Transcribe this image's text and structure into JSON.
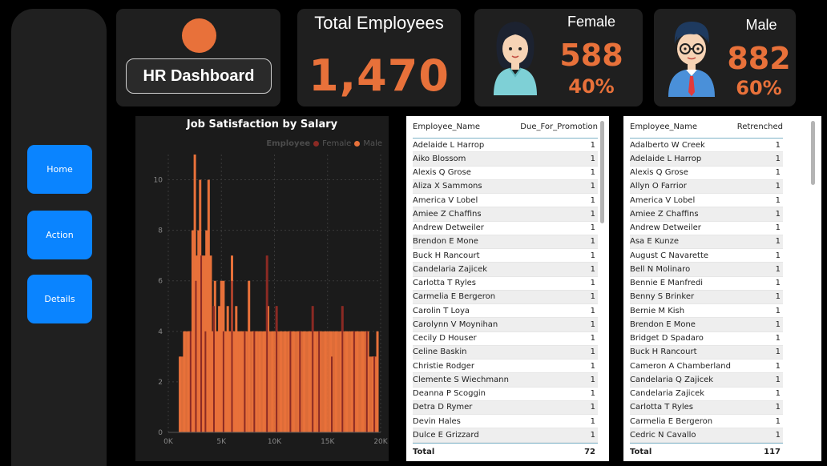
{
  "nav": {
    "home": "Home",
    "action": "Action",
    "details": "Details"
  },
  "header": {
    "dashboard_title": "HR Dashboard"
  },
  "kpi": {
    "total_title": "Total Employees",
    "total_value": "1,470",
    "female_title": "Female",
    "female_value": "588",
    "female_pct": "40%",
    "male_title": "Male",
    "male_value": "882",
    "male_pct": "60%"
  },
  "colors": {
    "accent": "#e8713a",
    "female_series": "#8b2a24",
    "male_series": "#e8713a",
    "nav_button": "#0a84ff"
  },
  "chart_data": {
    "type": "bar",
    "title": "Job Satisfaction by Salary",
    "legend_title": "Employee",
    "legend_position": "top-right",
    "xlim": [
      0,
      20000
    ],
    "ylim": [
      0,
      11
    ],
    "x_ticks": [
      "0K",
      "5K",
      "10K",
      "15K",
      "20K"
    ],
    "y_ticks": [
      "0",
      "2",
      "4",
      "6",
      "8",
      "10"
    ],
    "grid": true,
    "series": [
      {
        "name": "Female",
        "color": "#8b2a24",
        "points": [
          [
            2100,
            4
          ],
          [
            2600,
            6
          ],
          [
            3100,
            7
          ],
          [
            3500,
            4
          ],
          [
            4300,
            5
          ],
          [
            5200,
            4
          ],
          [
            6000,
            6
          ],
          [
            7200,
            4
          ],
          [
            8100,
            4
          ],
          [
            9300,
            7
          ],
          [
            10200,
            5
          ],
          [
            11500,
            4
          ],
          [
            12400,
            4
          ],
          [
            13600,
            5
          ],
          [
            14200,
            4
          ],
          [
            15400,
            3
          ],
          [
            16400,
            5
          ],
          [
            17500,
            4
          ],
          [
            18700,
            4
          ],
          [
            19400,
            3
          ]
        ]
      },
      {
        "name": "Male",
        "color": "#e8713a",
        "points": [
          [
            1100,
            3
          ],
          [
            1500,
            4
          ],
          [
            1900,
            4
          ],
          [
            2300,
            8
          ],
          [
            2500,
            11
          ],
          [
            2700,
            7
          ],
          [
            2850,
            8
          ],
          [
            3000,
            10
          ],
          [
            3200,
            7
          ],
          [
            3400,
            7
          ],
          [
            3600,
            8
          ],
          [
            3800,
            10
          ],
          [
            4000,
            7
          ],
          [
            4200,
            4
          ],
          [
            4400,
            6
          ],
          [
            4600,
            4
          ],
          [
            4800,
            5
          ],
          [
            5000,
            6
          ],
          [
            5200,
            6
          ],
          [
            5400,
            4
          ],
          [
            5600,
            5
          ],
          [
            5800,
            4
          ],
          [
            6000,
            7
          ],
          [
            6200,
            4
          ],
          [
            6400,
            5
          ],
          [
            6600,
            4
          ],
          [
            6800,
            4
          ],
          [
            7000,
            4
          ],
          [
            7300,
            4
          ],
          [
            7600,
            6
          ],
          [
            8000,
            4
          ],
          [
            8300,
            4
          ],
          [
            8600,
            4
          ],
          [
            9000,
            4
          ],
          [
            9400,
            5
          ],
          [
            9800,
            4
          ],
          [
            10200,
            4
          ],
          [
            10600,
            4
          ],
          [
            11000,
            4
          ],
          [
            11400,
            4
          ],
          [
            11800,
            4
          ],
          [
            12300,
            4
          ],
          [
            12800,
            4
          ],
          [
            13300,
            4
          ],
          [
            13800,
            4
          ],
          [
            14300,
            4
          ],
          [
            14800,
            4
          ],
          [
            15300,
            4
          ],
          [
            15800,
            4
          ],
          [
            16300,
            4
          ],
          [
            16800,
            4
          ],
          [
            17300,
            4
          ],
          [
            17800,
            4
          ],
          [
            18300,
            4
          ],
          [
            18800,
            4
          ],
          [
            19300,
            3
          ],
          [
            19700,
            4
          ]
        ]
      }
    ]
  },
  "promotion_table": {
    "col1": "Employee_Name",
    "col2": "Due_For_Promotion",
    "rows": [
      [
        "Adelaide L Harrop",
        "1"
      ],
      [
        "Aiko Blossom",
        "1"
      ],
      [
        "Alexis Q Grose",
        "1"
      ],
      [
        "Aliza X Sammons",
        "1"
      ],
      [
        "America V Lobel",
        "1"
      ],
      [
        "Amiee Z Chaffins",
        "1"
      ],
      [
        "Andrew Detweiler",
        "1"
      ],
      [
        "Brendon E Mone",
        "1"
      ],
      [
        "Buck H Rancourt",
        "1"
      ],
      [
        "Candelaria Zajicek",
        "1"
      ],
      [
        "Carlotta T Ryles",
        "1"
      ],
      [
        "Carmelia E Bergeron",
        "1"
      ],
      [
        "Carolin T Loya",
        "1"
      ],
      [
        "Carolynn V Moynihan",
        "1"
      ],
      [
        "Cecily D Houser",
        "1"
      ],
      [
        "Celine Baskin",
        "1"
      ],
      [
        "Christie Rodger",
        "1"
      ],
      [
        "Clemente S Wiechmann",
        "1"
      ],
      [
        "Deanna P Scoggin",
        "1"
      ],
      [
        "Detra D Rymer",
        "1"
      ],
      [
        "Devin Hales",
        "1"
      ],
      [
        "Dulce E Grizzard",
        "1"
      ]
    ],
    "total_label": "Total",
    "total_value": "72"
  },
  "retrenched_table": {
    "col1": "Employee_Name",
    "col2": "Retrenched",
    "rows": [
      [
        "Adalberto W Creek",
        "1"
      ],
      [
        "Adelaide L Harrop",
        "1"
      ],
      [
        "Alexis Q Grose",
        "1"
      ],
      [
        "Allyn O Farrior",
        "1"
      ],
      [
        "America V Lobel",
        "1"
      ],
      [
        "Amiee Z Chaffins",
        "1"
      ],
      [
        "Andrew Detweiler",
        "1"
      ],
      [
        "Asa E Kunze",
        "1"
      ],
      [
        "August C Navarette",
        "1"
      ],
      [
        "Bell N Molinaro",
        "1"
      ],
      [
        "Bennie E Manfredi",
        "1"
      ],
      [
        "Benny S Brinker",
        "1"
      ],
      [
        "Bernie M Kish",
        "1"
      ],
      [
        "Brendon E Mone",
        "1"
      ],
      [
        "Bridget D Spadaro",
        "1"
      ],
      [
        "Buck H Rancourt",
        "1"
      ],
      [
        "Cameron A Chamberland",
        "1"
      ],
      [
        "Candelaria Q Zajicek",
        "1"
      ],
      [
        "Candelaria Zajicek",
        "1"
      ],
      [
        "Carlotta T Ryles",
        "1"
      ],
      [
        "Carmelia E Bergeron",
        "1"
      ],
      [
        "Cedric N Cavallo",
        "1"
      ]
    ],
    "total_label": "Total",
    "total_value": "117"
  }
}
